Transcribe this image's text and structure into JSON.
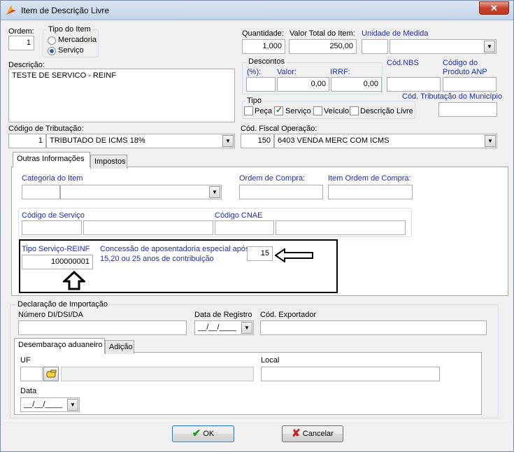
{
  "window": {
    "title": "Item de Descrição Livre",
    "close_label": "✕"
  },
  "ordem": {
    "label": "Ordem:",
    "value": "1"
  },
  "tipo_item": {
    "legend": "Tipo do Item",
    "options": [
      "Mercadoria",
      "Serviço"
    ],
    "selected": "Serviço"
  },
  "quantidade": {
    "label": "Quantidade:",
    "value": "1,000"
  },
  "valor_total": {
    "label": "Valor Total do Item:",
    "value": "250,00"
  },
  "unidade_medida": {
    "label": "Unidade de Medida",
    "code": "",
    "value": ""
  },
  "descricao": {
    "label": "Descrição:",
    "value": "TESTE DE SERVICO - REINF"
  },
  "descontos": {
    "legend": "Descontos",
    "pct_label": "(%):",
    "valor_label": "Valor:",
    "irrf_label": "IRRF:",
    "pct": "",
    "valor": "0,00",
    "irrf": "0,00"
  },
  "cod_nbs": {
    "label": "Cód.NBS",
    "value": ""
  },
  "cod_anp": {
    "label_line1": "Código do",
    "label_line2": "Produto ANP",
    "value": ""
  },
  "tipo": {
    "legend": "Tipo",
    "options": [
      "Peça",
      "Serviço",
      "Veículo",
      "Descrição Livre"
    ],
    "checked": [
      false,
      true,
      false,
      false
    ]
  },
  "cod_trib_municipio": {
    "label": "Cód. Tributação do Município",
    "value": ""
  },
  "codigo_tributacao": {
    "label": "Código de Tributação:",
    "code": "1",
    "value": "TRIBUTADO DE ICMS 18%"
  },
  "cod_fiscal": {
    "label": "Cód. Fiscal Operação:",
    "code": "150",
    "value": "6403 VENDA MERC COM ICMS"
  },
  "tabs_main": {
    "outras": "Outras Informações",
    "impostos": "Impostos"
  },
  "outras": {
    "categoria_label": "Categoria do Item",
    "ordem_compra_label": "Ordem de Compra:",
    "item_ordem_label": "Item Ordem de Compra:",
    "codigo_servico_label": "Código de Serviço",
    "codigo_cnae_label": "Código CNAE",
    "tipo_servico_label": "Tipo Serviço-REINF",
    "tipo_servico_value": "100000001",
    "concessao_line1": "Concessão de aposentadoria especial após",
    "concessao_line2": "15,20 ou 25 anos de contribuição",
    "concessao_value": "15"
  },
  "importacao": {
    "legend": "Declaração de Importação",
    "numero_label": "Número DI/DSI/DA",
    "data_registro_label": "Data de Registro",
    "data_registro_value": "__/__/____",
    "cod_exportador_label": "Cód. Exportador"
  },
  "tabs_sub": {
    "desembaraco": "Desembaraço aduaneiro",
    "adicao": "Adição"
  },
  "desembaraco": {
    "uf_label": "UF",
    "local_label": "Local",
    "data_label": "Data",
    "data_value": "__/__/____"
  },
  "buttons": {
    "ok": "OK",
    "cancelar": "Cancelar"
  }
}
